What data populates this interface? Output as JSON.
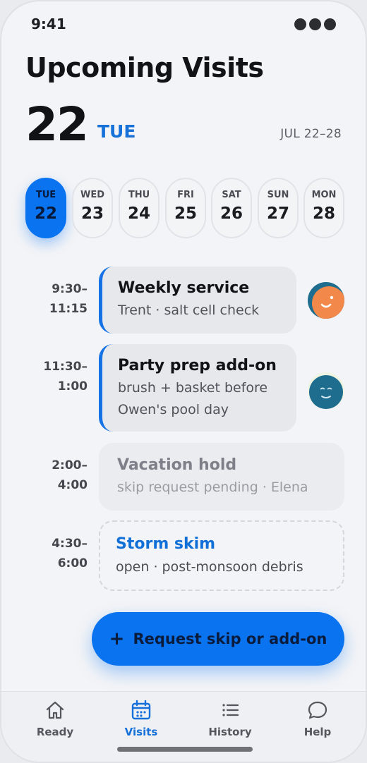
{
  "status": {
    "time": "9:41"
  },
  "header": {
    "title": "Upcoming Visits",
    "day_number": "22",
    "day_of_week": "TUE",
    "range": "JUL 22–28"
  },
  "days": [
    {
      "dow": "TUE",
      "num": "22",
      "selected": true
    },
    {
      "dow": "WED",
      "num": "23",
      "selected": false
    },
    {
      "dow": "THU",
      "num": "24",
      "selected": false
    },
    {
      "dow": "FRI",
      "num": "25",
      "selected": false
    },
    {
      "dow": "SAT",
      "num": "26",
      "selected": false
    },
    {
      "dow": "SUN",
      "num": "27",
      "selected": false
    },
    {
      "dow": "MON",
      "num": "28",
      "selected": false
    }
  ],
  "visits": [
    {
      "start": "9:30–",
      "end": "11:15",
      "title": "Weekly service",
      "lines": [
        "Trent · salt cell check"
      ],
      "status": "scheduled",
      "avatar": "orange-face-avatar"
    },
    {
      "start": "11:30–",
      "end": "1:00",
      "title": "Party prep add-on",
      "lines": [
        "brush + basket before",
        "Owen's pool day"
      ],
      "status": "scheduled",
      "avatar": "teal-face-avatar"
    },
    {
      "start": "2:00–",
      "end": "4:00",
      "title": "Vacation hold",
      "lines": [
        "skip request pending · Elena"
      ],
      "status": "pending"
    },
    {
      "start": "4:30–",
      "end": "6:00",
      "title": "Storm skim",
      "lines": [
        "open · post-monsoon debris"
      ],
      "status": "open"
    }
  ],
  "action": {
    "plus": "+",
    "label": "Request skip or add-on"
  },
  "tabs": [
    {
      "label": "Ready",
      "icon": "home-icon",
      "active": false
    },
    {
      "label": "Visits",
      "icon": "calendar-icon",
      "active": true
    },
    {
      "label": "History",
      "icon": "list-icon",
      "active": false
    },
    {
      "label": "Help",
      "icon": "chat-bubble-icon",
      "active": false
    }
  ],
  "colors": {
    "accent": "#0a73f0",
    "accent_text": "#1671d9",
    "background": "#f3f4f7"
  }
}
